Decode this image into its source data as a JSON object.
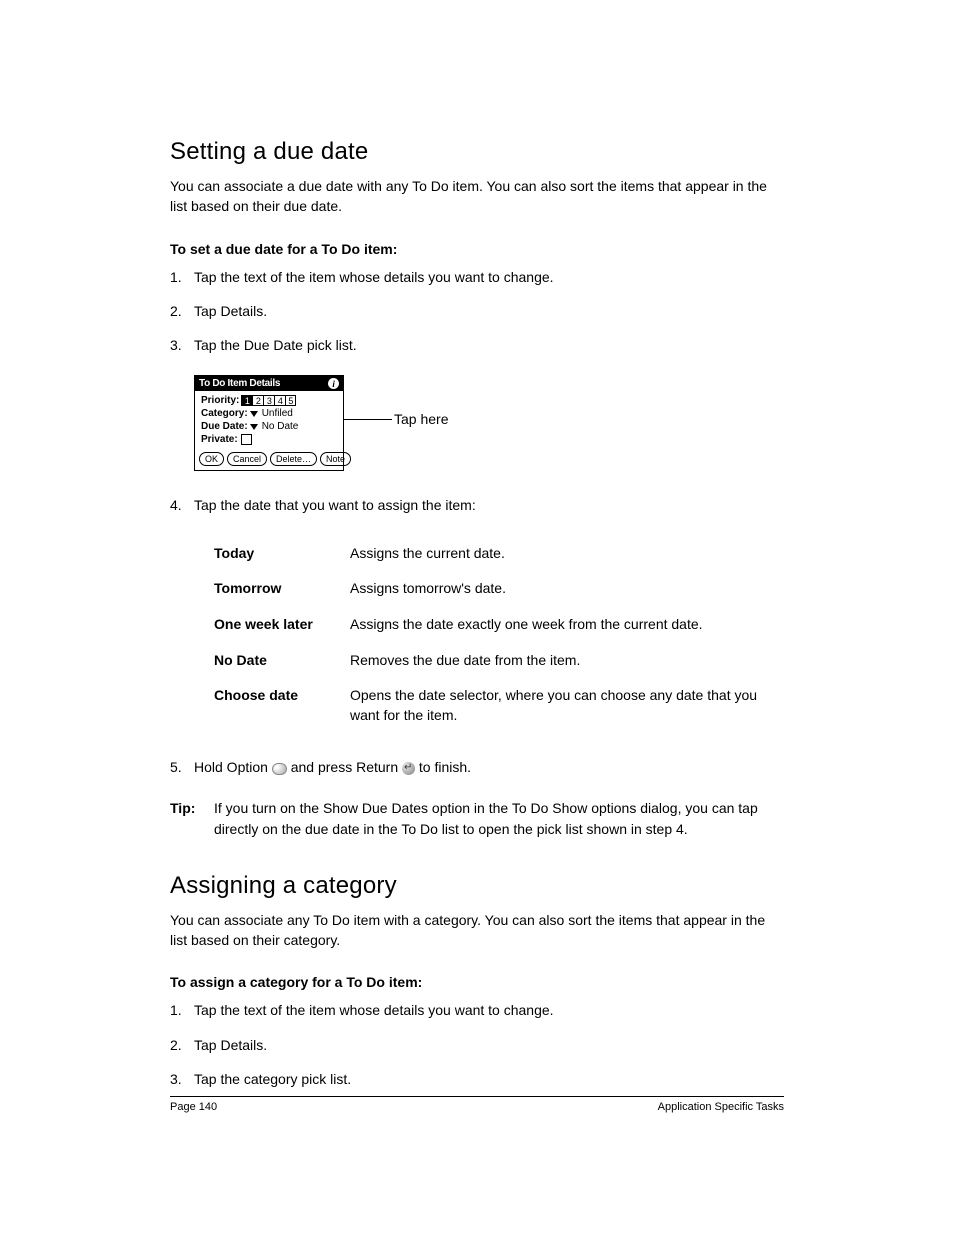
{
  "section1": {
    "title": "Setting a due date",
    "intro": "You can associate a due date with any To Do item. You can also sort the items that appear in the list based on their due date.",
    "subhead": "To set a due date for a To Do item:",
    "steps": {
      "s1": "Tap the text of the item whose details you want to change.",
      "s2": "Tap Details.",
      "s3": "Tap the Due Date pick list.",
      "s4": "Tap the date that you want to assign the item:",
      "s5a": "Hold Option ",
      "s5b": " and press Return ",
      "s5c": " to finish."
    }
  },
  "palm": {
    "title": "To Do Item Details",
    "priority_label": "Priority:",
    "priority_values": [
      "1",
      "2",
      "3",
      "4",
      "5"
    ],
    "priority_selected": "1",
    "category_label": "Category:",
    "category_value": "Unfiled",
    "duedate_label": "Due Date:",
    "duedate_value": "No Date",
    "private_label": "Private:",
    "buttons": {
      "ok": "OK",
      "cancel": "Cancel",
      "delete": "Delete…",
      "note": "Note"
    }
  },
  "callout": "Tap here",
  "date_options": [
    {
      "term": "Today",
      "desc": "Assigns the current date."
    },
    {
      "term": "Tomorrow",
      "desc": "Assigns tomorrow's date."
    },
    {
      "term": "One week later",
      "desc": "Assigns the date exactly one week from the current date."
    },
    {
      "term": "No Date",
      "desc": "Removes the due date from the item."
    },
    {
      "term": "Choose date",
      "desc": "Opens the date selector, where you can choose any date that you want for the item."
    }
  ],
  "tip": {
    "label": "Tip:",
    "body": "If you turn on the Show Due Dates option in the To Do Show options dialog, you can tap directly on the due date in the To Do list to open the pick list shown in step 4."
  },
  "section2": {
    "title": "Assigning a category",
    "intro": "You can associate any To Do item with a category. You can also sort the items that appear in the list based on their category.",
    "subhead": "To assign a category for a To Do item:",
    "steps": {
      "s1": "Tap the text of the item whose details you want to change.",
      "s2": "Tap Details.",
      "s3": "Tap the category pick list."
    }
  },
  "footer": {
    "left": "Page 140",
    "right": "Application Specific Tasks"
  },
  "nums": {
    "n1": "1.",
    "n2": "2.",
    "n3": "3.",
    "n4": "4.",
    "n5": "5."
  }
}
